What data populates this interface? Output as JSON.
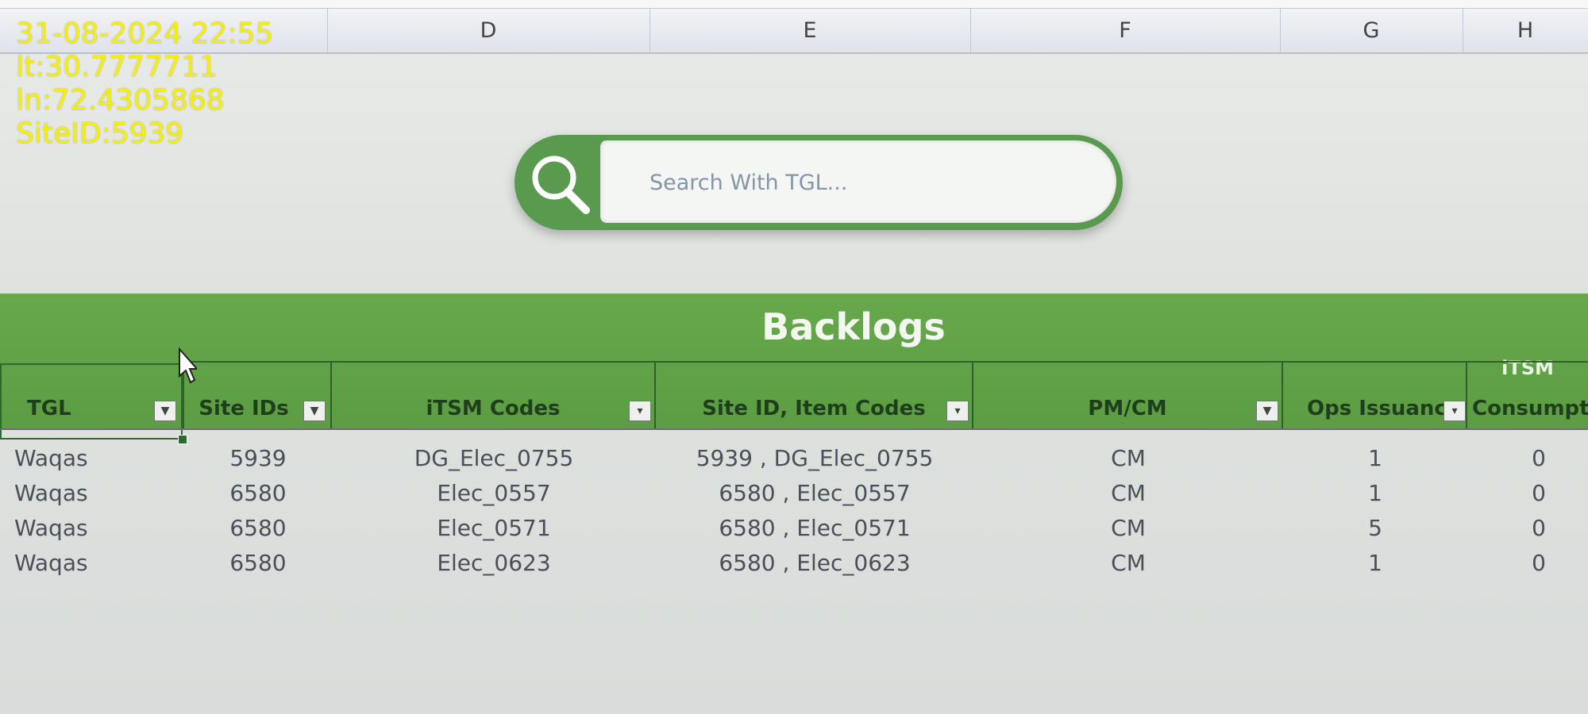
{
  "overlay": {
    "datetime": "31-08-2024 22:55",
    "latitude": "lt:30.7777711",
    "longitude": "ln:72.4305868",
    "site_id": "SiteID:5939"
  },
  "columns": [
    "D",
    "E",
    "F",
    "G",
    "H"
  ],
  "search": {
    "placeholder": "Search With TGL..."
  },
  "table": {
    "title": "Backlogs",
    "headers": {
      "tgl": "TGL",
      "site_ids": "Site IDs",
      "itsm_codes": "iTSM Codes",
      "site_item_codes": "Site ID, Item Codes",
      "pm_cm": "PM/CM",
      "ops_issuance": "Ops Issuance",
      "itsm_consumption_top": "iTSM",
      "itsm_consumption_bottom": "Consumptio"
    },
    "rows": [
      {
        "tgl": "Waqas",
        "site_id": "5939",
        "itsm_code": "DG_Elec_0755",
        "site_item": "5939 , DG_Elec_0755",
        "pm_cm": "CM",
        "ops_issuance": "1",
        "itsm_consumption": "0"
      },
      {
        "tgl": "Waqas",
        "site_id": "6580",
        "itsm_code": "Elec_0557",
        "site_item": "6580 , Elec_0557",
        "pm_cm": "CM",
        "ops_issuance": "1",
        "itsm_consumption": "0"
      },
      {
        "tgl": "Waqas",
        "site_id": "6580",
        "itsm_code": "Elec_0571",
        "site_item": "6580 , Elec_0571",
        "pm_cm": "CM",
        "ops_issuance": "5",
        "itsm_consumption": "0"
      },
      {
        "tgl": "Waqas",
        "site_id": "6580",
        "itsm_code": "Elec_0623",
        "site_item": "6580 , Elec_0623",
        "pm_cm": "CM",
        "ops_issuance": "1",
        "itsm_consumption": "0"
      }
    ]
  },
  "colors": {
    "header_green": "#5f9f46",
    "search_green": "#5a9a4e",
    "overlay_yellow": "#f5f000"
  }
}
